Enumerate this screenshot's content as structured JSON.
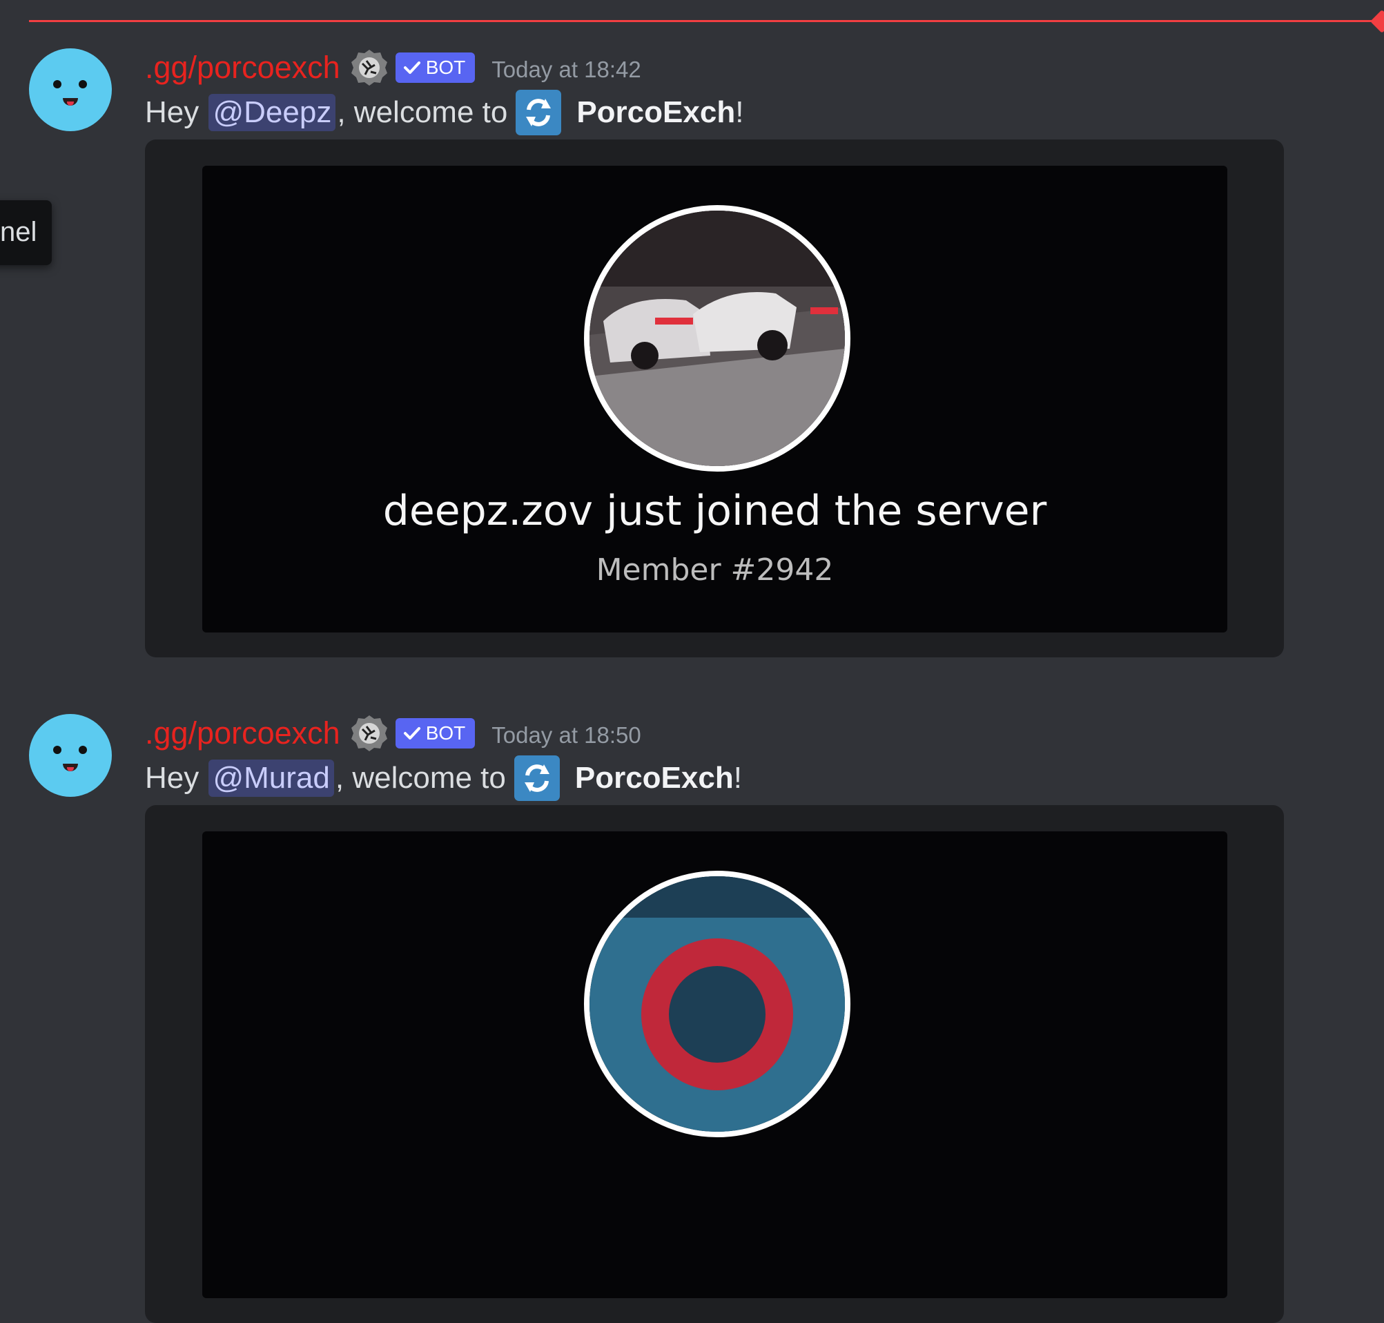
{
  "tooltip": {
    "text": "nel"
  },
  "messages": [
    {
      "author": ".gg/porcoexch",
      "bot_label": "BOT",
      "timestamp": "Today at 18:42",
      "greeting": "Hey",
      "mention": "@Deepz",
      "welcome": ", welcome to",
      "server_name": "PorcoExch",
      "exclaim": "!",
      "embed": {
        "join_text": "deepz.zov just joined the server",
        "member_text": "Member #2942"
      }
    },
    {
      "author": ".gg/porcoexch",
      "bot_label": "BOT",
      "timestamp": "Today at 18:50",
      "greeting": "Hey",
      "mention": "@Murad",
      "welcome": ", welcome to",
      "server_name": "PorcoExch",
      "exclaim": "!"
    }
  ],
  "colors": {
    "author": "#e8231f",
    "bot_badge": "#5865f2",
    "new_divider": "#f23f42",
    "avatar": "#5ccbf0"
  },
  "icons": [
    "server-tag-icon",
    "checkmark-icon",
    "repeat-arrows-icon"
  ]
}
